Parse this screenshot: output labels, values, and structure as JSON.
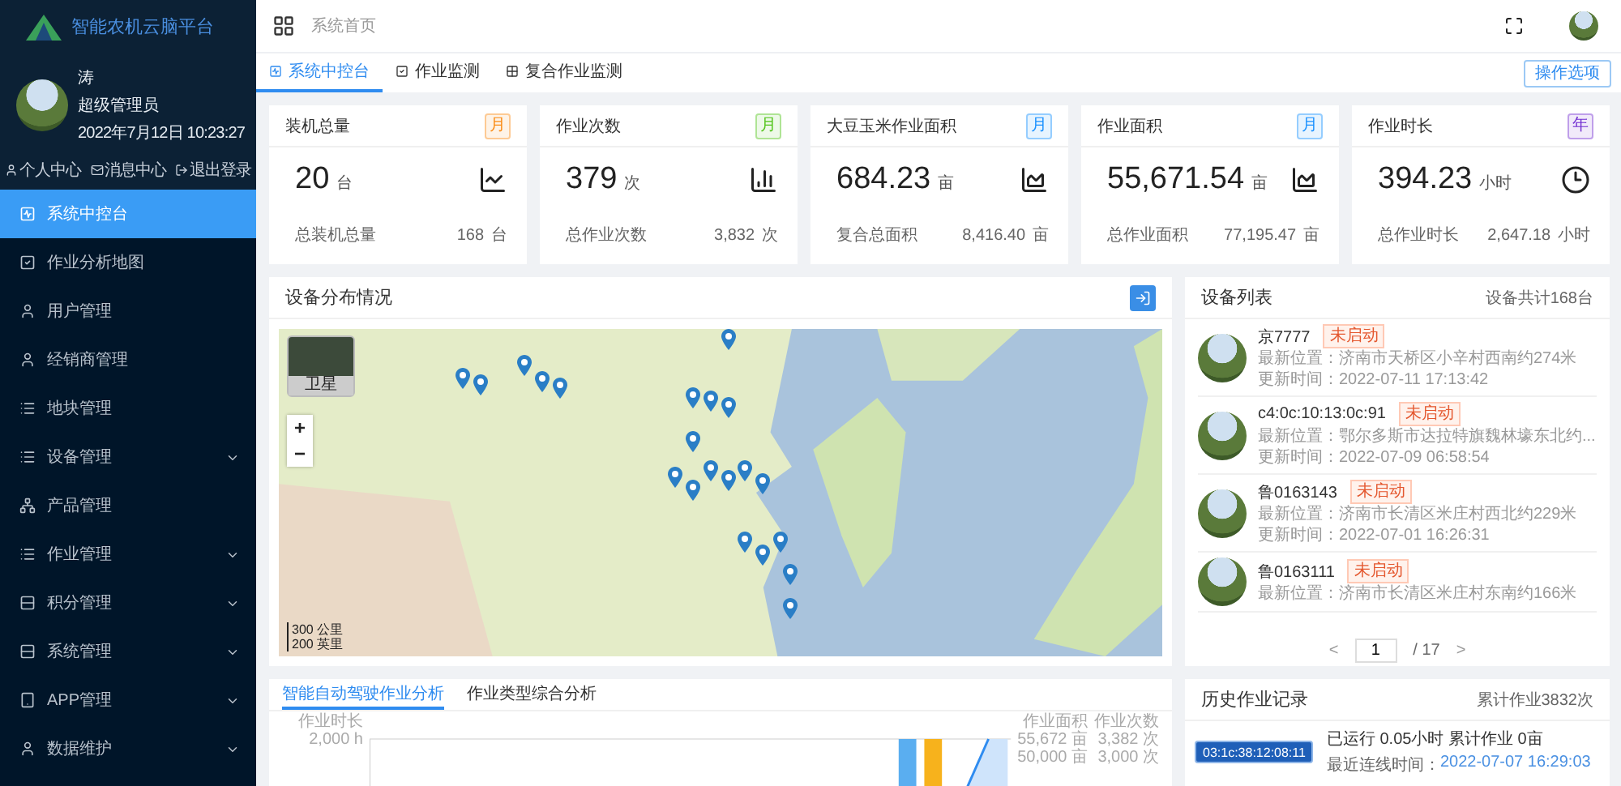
{
  "sidebar": {
    "brand": "智能农机云脑平台",
    "user": {
      "name": "涛",
      "role": "超级管理员",
      "datetime": "2022年7月12日 10:23:27"
    },
    "user_links": [
      {
        "label": "个人中心",
        "kind": "profile"
      },
      {
        "label": "消息中心",
        "kind": "messages"
      },
      {
        "label": "退出登录",
        "kind": "logout"
      }
    ],
    "menu": [
      {
        "label": "系统中控台",
        "selected": true,
        "has_submenu": false
      },
      {
        "label": "作业分析地图",
        "selected": false,
        "has_submenu": false
      },
      {
        "label": "用户管理",
        "selected": false,
        "has_submenu": false
      },
      {
        "label": "经销商管理",
        "selected": false,
        "has_submenu": false
      },
      {
        "label": "地块管理",
        "selected": false,
        "has_submenu": false
      },
      {
        "label": "设备管理",
        "selected": false,
        "has_submenu": true
      },
      {
        "label": "产品管理",
        "selected": false,
        "has_submenu": false
      },
      {
        "label": "作业管理",
        "selected": false,
        "has_submenu": true
      },
      {
        "label": "积分管理",
        "selected": false,
        "has_submenu": true
      },
      {
        "label": "系统管理",
        "selected": false,
        "has_submenu": true
      },
      {
        "label": "APP管理",
        "selected": false,
        "has_submenu": true
      },
      {
        "label": "数据维护",
        "selected": false,
        "has_submenu": true
      }
    ]
  },
  "header": {
    "breadcrumb": "系统首页"
  },
  "tabs": [
    {
      "label": "系统中控台",
      "selected": true
    },
    {
      "label": "作业监测",
      "selected": false
    },
    {
      "label": "复合作业监测",
      "selected": false
    }
  ],
  "options_button": "操作选项",
  "stats": [
    {
      "title": "装机总量",
      "period": "月",
      "color": "#fa8c16",
      "value": "20",
      "unit": "台",
      "total_label": "总装机总量",
      "total_value": "168",
      "total_unit": "台"
    },
    {
      "title": "作业次数",
      "period": "月",
      "color": "#52c41a",
      "value": "379",
      "unit": "次",
      "total_label": "总作业次数",
      "total_value": "3,832",
      "total_unit": "次"
    },
    {
      "title": "大豆玉米作业面积",
      "period": "月",
      "color": "#1890ff",
      "value": "684.23",
      "unit": "亩",
      "total_label": "复合总面积",
      "total_value": "8,416.40",
      "total_unit": "亩"
    },
    {
      "title": "作业面积",
      "period": "月",
      "color": "#1890ff",
      "value": "55,671.54",
      "unit": "亩",
      "total_label": "总作业面积",
      "total_value": "77,195.47",
      "total_unit": "亩"
    },
    {
      "title": "作业时长",
      "period": "年",
      "color": "#722ed1",
      "value": "394.23",
      "unit": "小时",
      "total_label": "总作业时长",
      "total_value": "2,647.18",
      "total_unit": "小时"
    }
  ],
  "map_panel": {
    "title": "设备分布情况",
    "layer_label": "卫星",
    "zoom_in": "+",
    "zoom_out": "−",
    "scale": [
      "300 公里",
      "200 英里"
    ]
  },
  "device_list": {
    "title": "设备列表",
    "total": "设备共计168台",
    "items": [
      {
        "name": "京7777",
        "status": "未启动",
        "location": "最新位置：济南市天桥区小辛村西南约274米",
        "updated": "更新时间：2022-07-11 17:13:42"
      },
      {
        "name": "c4:0c:10:13:0c:91",
        "status": "未启动",
        "location": "最新位置：鄂尔多斯市达拉特旗魏林壕东北约...",
        "updated": "更新时间：2022-07-09 06:58:54"
      },
      {
        "name": "鲁0163143",
        "status": "未启动",
        "location": "最新位置：济南市长清区米庄村西北约229米",
        "updated": "更新时间：2022-07-01 16:26:31"
      },
      {
        "name": "鲁0163111",
        "status": "未启动",
        "location": "最新位置：济南市长清区米庄村东南约166米"
      }
    ],
    "pagination": {
      "prev": "<",
      "page": "1",
      "pages": "/ 17",
      "next": ">"
    }
  },
  "analysis": {
    "tabs": [
      {
        "label": "智能自动驾驶作业分析",
        "selected": true
      },
      {
        "label": "作业类型综合分析",
        "selected": false
      }
    ],
    "left_axis_title": "作业时长",
    "left_tick": "2,000 h",
    "right_axes": [
      {
        "title": "作业面积",
        "ticks": [
          "55,672 亩",
          "50,000 亩"
        ]
      },
      {
        "title": "作业次数",
        "ticks": [
          "3,382 次",
          "3,000 次"
        ]
      }
    ]
  },
  "history": {
    "title": "历史作业记录",
    "total": "累计作业3832次",
    "records": [
      {
        "device": "03:1c:38:12:08:11",
        "summary": "已运行 0.05小时 累计作业 0亩",
        "last_online_label": "最近连线时间：",
        "last_online": "2022-07-07 16:29:03"
      }
    ]
  }
}
